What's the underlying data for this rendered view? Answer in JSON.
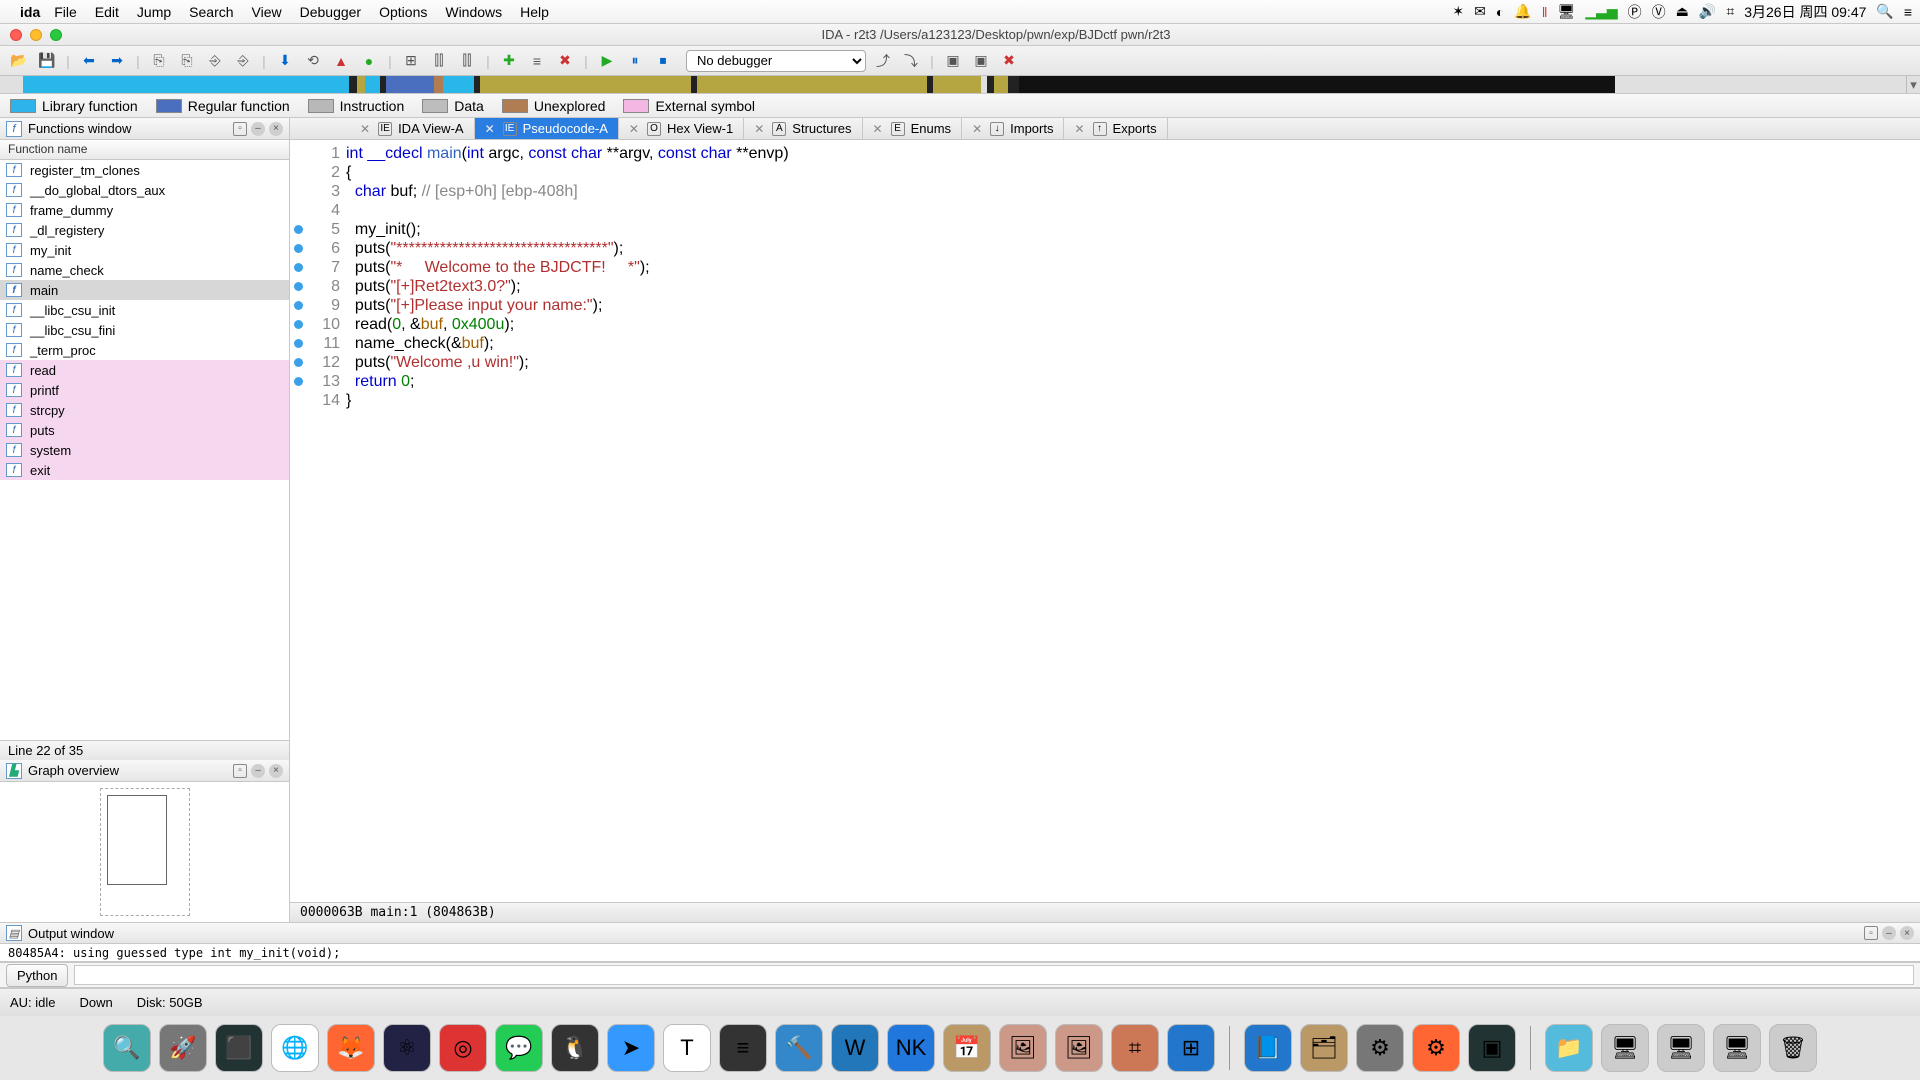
{
  "menubar": {
    "app": "ida",
    "items": [
      "File",
      "Edit",
      "Jump",
      "Search",
      "View",
      "Debugger",
      "Options",
      "Windows",
      "Help"
    ],
    "right": {
      "date": "3月26日 周四 09:47"
    }
  },
  "window": {
    "title": "IDA - r2t3 /Users/a123123/Desktop/pwn/exp/BJDctf pwn/r2t3"
  },
  "toolbar": {
    "debugger_selector": "No debugger"
  },
  "legend": {
    "items": [
      {
        "color": "#2fb4e9",
        "label": "Library function"
      },
      {
        "color": "#4a6fbf",
        "label": "Regular function"
      },
      {
        "color": "#b8b8b8",
        "label": "Instruction"
      },
      {
        "color": "#bdbdbd",
        "label": "Data"
      },
      {
        "color": "#b07c52",
        "label": "Unexplored"
      },
      {
        "color": "#f4b6e2",
        "label": "External symbol"
      }
    ]
  },
  "panels": {
    "functions": {
      "title": "Functions window",
      "header": "Function name",
      "status": "Line 22 of 35",
      "rows": [
        {
          "name": "register_tm_clones",
          "sel": false,
          "pink": false
        },
        {
          "name": "__do_global_dtors_aux",
          "sel": false,
          "pink": false
        },
        {
          "name": "frame_dummy",
          "sel": false,
          "pink": false
        },
        {
          "name": "_dl_registery",
          "sel": false,
          "pink": false
        },
        {
          "name": "my_init",
          "sel": false,
          "pink": false
        },
        {
          "name": "name_check",
          "sel": false,
          "pink": false
        },
        {
          "name": "main",
          "sel": true,
          "pink": false
        },
        {
          "name": "__libc_csu_init",
          "sel": false,
          "pink": false
        },
        {
          "name": "__libc_csu_fini",
          "sel": false,
          "pink": false
        },
        {
          "name": "_term_proc",
          "sel": false,
          "pink": false
        },
        {
          "name": "read",
          "sel": false,
          "pink": true
        },
        {
          "name": "printf",
          "sel": false,
          "pink": true
        },
        {
          "name": "strcpy",
          "sel": false,
          "pink": true
        },
        {
          "name": "puts",
          "sel": false,
          "pink": true
        },
        {
          "name": "system",
          "sel": false,
          "pink": true
        },
        {
          "name": "exit",
          "sel": false,
          "pink": true
        }
      ]
    },
    "graphov": {
      "title": "Graph overview"
    },
    "output": {
      "title": "Output window",
      "line": "80485A4: using guessed type int my_init(void);",
      "python_label": "Python"
    }
  },
  "tabs": [
    {
      "label": "IDA View-A",
      "active": false,
      "ic": "IE"
    },
    {
      "label": "Pseudocode-A",
      "active": true,
      "ic": "IE"
    },
    {
      "label": "Hex View-1",
      "active": false,
      "ic": "O"
    },
    {
      "label": "Structures",
      "active": false,
      "ic": "A"
    },
    {
      "label": "Enums",
      "active": false,
      "ic": "E"
    },
    {
      "label": "Imports",
      "active": false,
      "ic": "↓"
    },
    {
      "label": "Exports",
      "active": false,
      "ic": "↑"
    }
  ],
  "code": {
    "status": "0000063B  main:1 (804863B)",
    "lines": [
      {
        "n": 1,
        "dot": false,
        "html": "<span class='kw'>int</span> <span class='kw'>__cdecl</span> <span class='ident'>main</span>(<span class='kw'>int</span> argc, <span class='kw'>const char</span> **argv, <span class='kw'>const char</span> **envp)"
      },
      {
        "n": 2,
        "dot": false,
        "html": "{"
      },
      {
        "n": 3,
        "dot": false,
        "html": "  <span class='kw'>char</span> buf; <span class='cmt'>// [esp+0h] [ebp-408h]</span>"
      },
      {
        "n": 4,
        "dot": false,
        "html": ""
      },
      {
        "n": 5,
        "dot": true,
        "html": "  my_init();"
      },
      {
        "n": 6,
        "dot": true,
        "html": "  puts(<span class='str'>&quot;**********************************&quot;</span>);"
      },
      {
        "n": 7,
        "dot": true,
        "html": "  puts(<span class='str'>&quot;*     Welcome to the BJDCTF!     *&quot;</span>);"
      },
      {
        "n": 8,
        "dot": true,
        "html": "  puts(<span class='str'>&quot;[+]Ret2text3.0?&quot;</span>);"
      },
      {
        "n": 9,
        "dot": true,
        "html": "  puts(<span class='str'>&quot;[+]Please input your name:&quot;</span>);"
      },
      {
        "n": 10,
        "dot": true,
        "html": "  read(<span class='num'>0</span>, &amp;<span class='var'>buf</span>, <span class='num'>0x400u</span>);"
      },
      {
        "n": 11,
        "dot": true,
        "html": "  name_check(&amp;<span class='var'>buf</span>);"
      },
      {
        "n": 12,
        "dot": true,
        "html": "  puts(<span class='str'>&quot;Welcome ,u win!&quot;</span>);"
      },
      {
        "n": 13,
        "dot": true,
        "html": "  <span class='kw'>return</span> <span class='num'>0</span>;"
      },
      {
        "n": 14,
        "dot": false,
        "html": "}"
      }
    ]
  },
  "bottom": {
    "au": "AU:  idle",
    "down": "Down",
    "disk": "Disk: 50GB"
  },
  "dock_icons": [
    "🔍",
    "🚀",
    "⬛",
    "🌐",
    "🦊",
    "⚛",
    "◎",
    "💬",
    "🐧",
    "➤",
    "T",
    "≡",
    "🔨",
    "W",
    "NK",
    "📅",
    "🖼",
    "🖼",
    "⌗",
    "⊞",
    "",
    "📘",
    "🗂",
    "⚙",
    "⚙",
    "▣",
    "",
    "📁",
    "🖥",
    "🖥",
    "🖥",
    "🗑"
  ]
}
